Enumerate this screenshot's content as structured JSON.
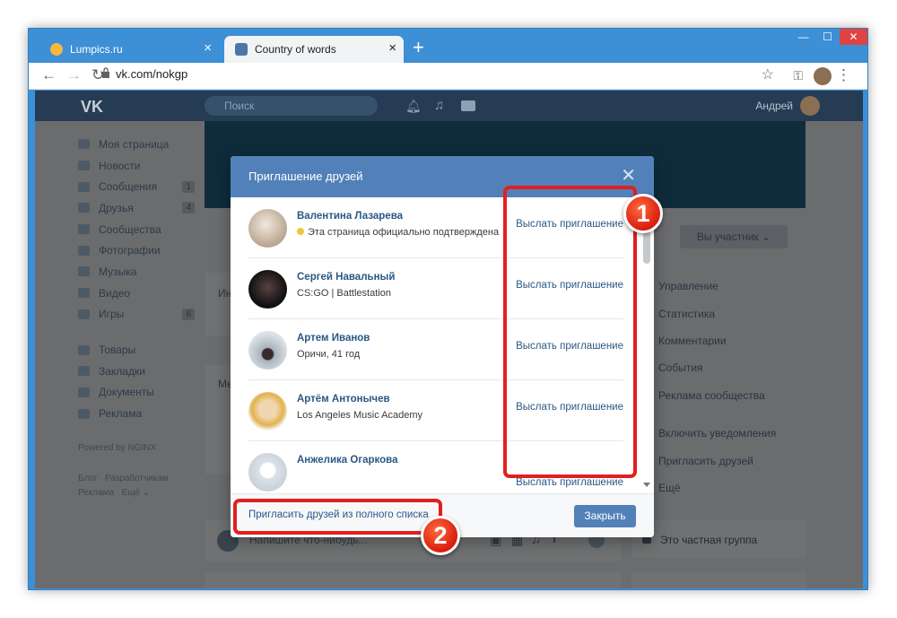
{
  "browser": {
    "tabs": [
      {
        "title": "Lumpics.ru",
        "favicon_color": "#f6b73c"
      },
      {
        "title": "Country of words",
        "favicon_color": "#4a76a8"
      }
    ],
    "new_tab": "+",
    "close_glyph": "×",
    "url": "vk.com/nokgp",
    "window_controls": [
      "—",
      "☐",
      "✕"
    ]
  },
  "vk": {
    "logo": "VK",
    "search_placeholder": "Поиск",
    "user_name": "Андрей",
    "left_menu": [
      {
        "label": "Моя страница"
      },
      {
        "label": "Новости"
      },
      {
        "label": "Сообщения",
        "count": "1"
      },
      {
        "label": "Друзья",
        "count": "4"
      },
      {
        "label": "Сообщества"
      },
      {
        "label": "Фотографии"
      },
      {
        "label": "Музыка"
      },
      {
        "label": "Видео"
      },
      {
        "label": "Игры",
        "count": "6"
      }
    ],
    "left_menu_2": [
      {
        "label": "Товары"
      },
      {
        "label": "Закладки"
      },
      {
        "label": "Документы"
      },
      {
        "label": "Реклама"
      }
    ],
    "powered": "Powered by NGINX",
    "footer_links": [
      "Блог",
      "Разработчикам",
      "Реклама",
      "Ещё ⌄"
    ],
    "member_button": "Вы участник ⌄",
    "right_menu": [
      {
        "label": "Управление"
      },
      {
        "label": "Статистика"
      },
      {
        "label": "Комментарии"
      },
      {
        "label": "События"
      },
      {
        "label": "Реклама сообщества"
      }
    ],
    "right_menu_2": [
      {
        "label": "Включить уведомления"
      },
      {
        "label": "Пригласить друзей"
      },
      {
        "label": "Ещё"
      }
    ],
    "post_placeholder": "Напишите что-нибудь...",
    "private_group": "Это частная группа",
    "partial_tab": "Ин",
    "partial_me": "Ме"
  },
  "modal": {
    "title": "Приглашение друзей",
    "close_glyph": "✕",
    "invite_label": "Выслать приглашение",
    "friends": [
      {
        "name": "Валентина Лазарева",
        "subtitle": "Эта страница официально подтверждена",
        "verified": true,
        "avatar_color": "#c9b8a8"
      },
      {
        "name": "Сергей Навальный",
        "subtitle": "CS:GO | Battlestation",
        "verified": false,
        "avatar_color": "#1a1a1a"
      },
      {
        "name": "Артем Иванов",
        "subtitle": "Оричи, 41 год",
        "verified": false,
        "avatar_color": "#9aa3ad"
      },
      {
        "name": "Артём Антонычев",
        "subtitle": "Los Angeles Music Academy",
        "verified": false,
        "avatar_color": "#e9c98a"
      },
      {
        "name": "Анжелика Огаркова",
        "subtitle": "",
        "verified": false,
        "avatar_color": "#dfe3e8"
      }
    ],
    "full_list_link": "Пригласить друзей из полного списка",
    "close_button": "Закрыть"
  },
  "annotations": {
    "badge1": "1",
    "badge2": "2",
    "highlight_color": "#e21f1f"
  }
}
